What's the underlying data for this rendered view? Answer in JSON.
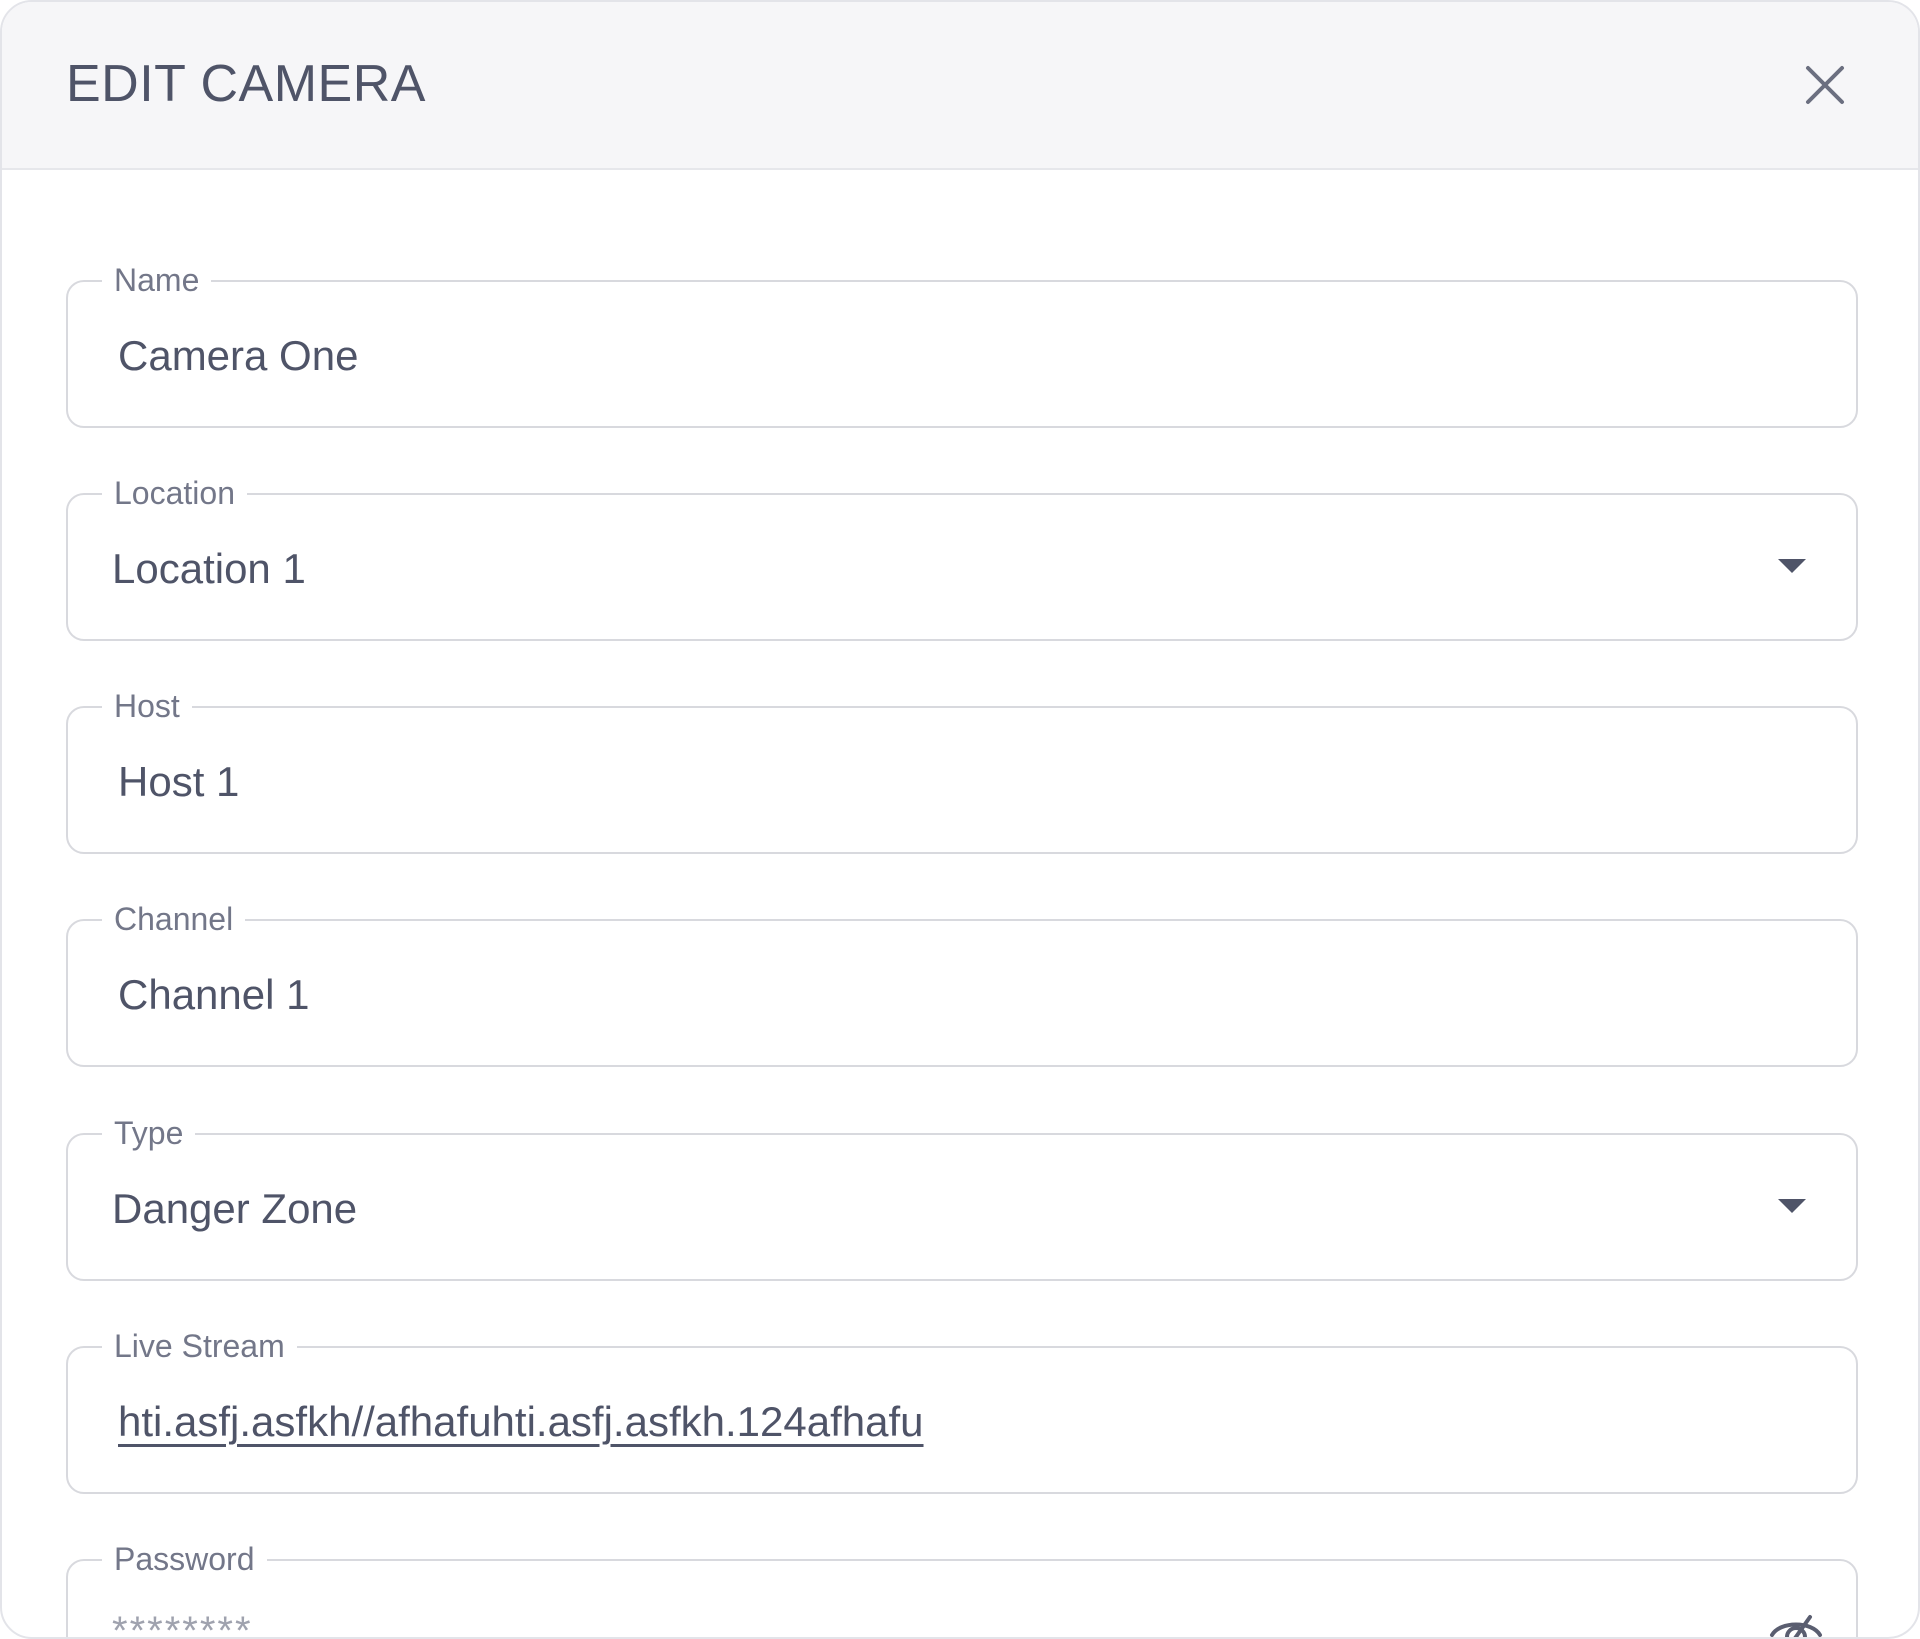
{
  "dialog": {
    "title": "EDIT CAMERA",
    "close_icon": "close-icon"
  },
  "fields": {
    "name": {
      "label": "Name",
      "value": "Camera One"
    },
    "location": {
      "label": "Location",
      "value": "Location 1",
      "icon": "chevron-down-icon"
    },
    "host": {
      "label": "Host",
      "value": "Host 1"
    },
    "channel": {
      "label": "Channel",
      "value": "Channel 1"
    },
    "type": {
      "label": "Type",
      "value": "Danger Zone",
      "icon": "chevron-down-icon"
    },
    "live_stream": {
      "label": "Live Stream",
      "value": "hti.asfj.asfkh//afhafuhti.asfj.asfkh.124afhafu"
    },
    "password": {
      "label": "Password",
      "value": "********",
      "icon": "eye-off-icon"
    }
  },
  "colors": {
    "header_bg": "#f6f6f8",
    "text": "#4f5468",
    "label": "#737789",
    "border": "#d8d9de"
  }
}
